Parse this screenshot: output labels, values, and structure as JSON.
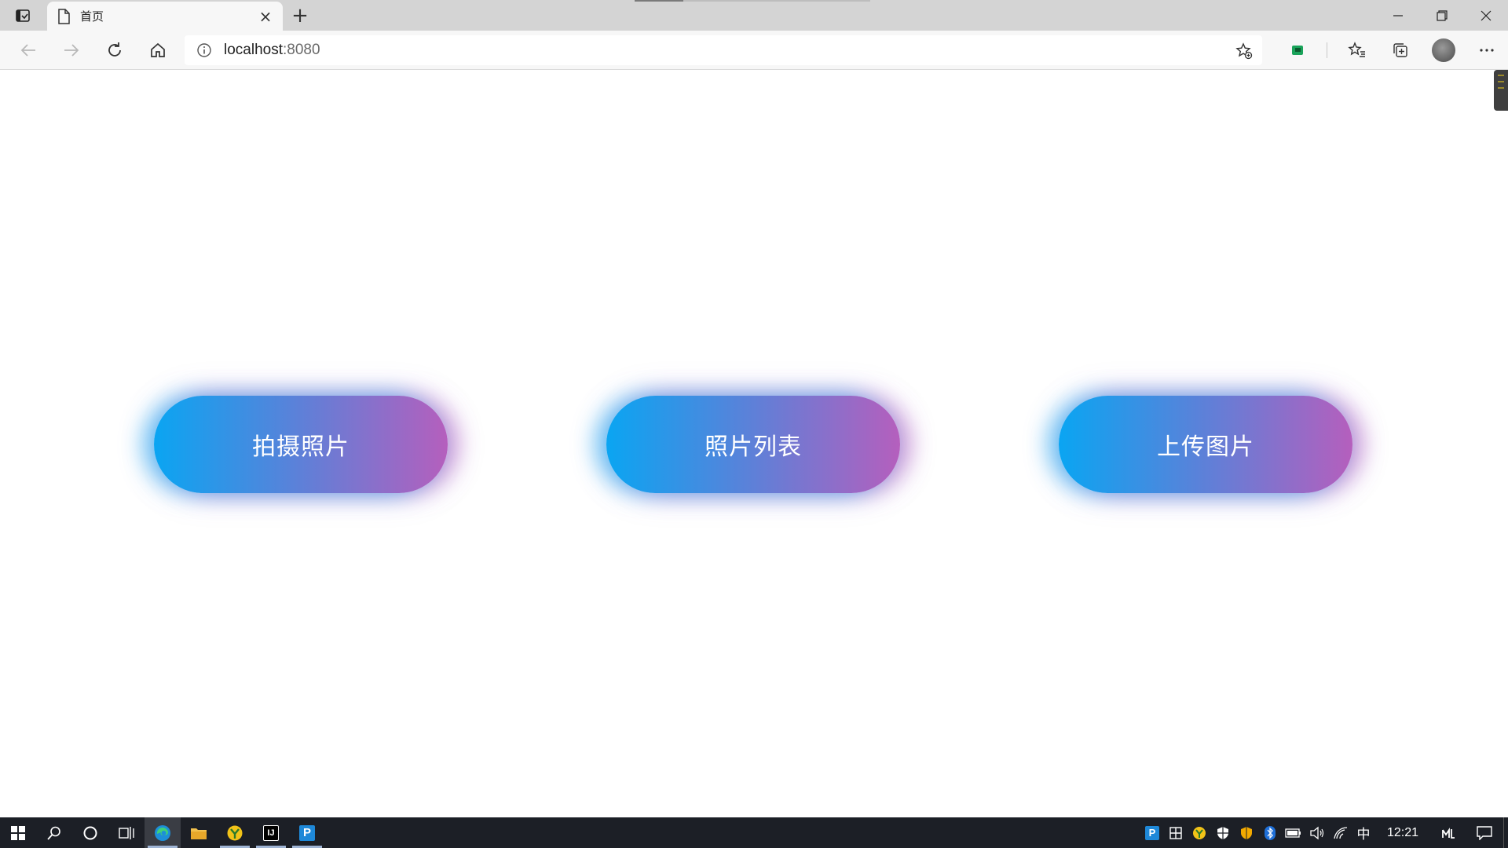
{
  "browser": {
    "tab_title": "首页",
    "tab_close": "×",
    "new_tab": "+",
    "address": "localhost",
    "address_port": ":8080"
  },
  "page": {
    "buttons": [
      {
        "label": "拍摄照片"
      },
      {
        "label": "照片列表"
      },
      {
        "label": "上传图片"
      }
    ],
    "button_gradient": {
      "start": "#0aa5f2",
      "end": "#b55fbd"
    }
  },
  "taskbar": {
    "clock": "12:21",
    "ime": "中",
    "apps": [
      "windows-start-icon",
      "search-icon",
      "cortana-icon",
      "task-view-icon",
      "edge-icon",
      "file-explorer-icon",
      "app-icon",
      "intellij-icon",
      "pycharm-icon"
    ]
  },
  "tray": {
    "pycharm_badge": "P",
    "intellij_badge": "IJ"
  }
}
